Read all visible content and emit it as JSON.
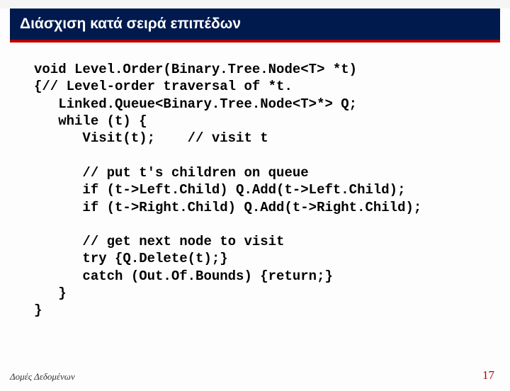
{
  "title": "Διάσχιση κατά σειρά επιπέδων",
  "code": "void Level.Order(Binary.Tree.Node<T> *t)\n{// Level-order traversal of *t.\n   Linked.Queue<Binary.Tree.Node<T>*> Q;\n   while (t) {\n      Visit(t);    // visit t\n\n      // put t's children on queue\n      if (t->Left.Child) Q.Add(t->Left.Child);\n      if (t->Right.Child) Q.Add(t->Right.Child);\n\n      // get next node to visit\n      try {Q.Delete(t);}\n      catch (Out.Of.Bounds) {return;}\n   }\n}",
  "footer_left": "Δομές Δεδομένων",
  "footer_right": "17"
}
